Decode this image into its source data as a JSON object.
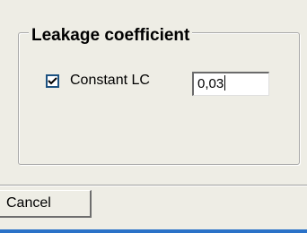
{
  "group": {
    "title": "Leakage coefficient"
  },
  "constant_lc": {
    "label": "Constant LC",
    "checked": true,
    "value": "0,03"
  },
  "footer": {
    "cancel_label": "Cancel"
  },
  "colors": {
    "dialog_bg": "#eeede5",
    "checkbox_border": "#1c5180",
    "taskbar_accent": "#2a72c8"
  }
}
